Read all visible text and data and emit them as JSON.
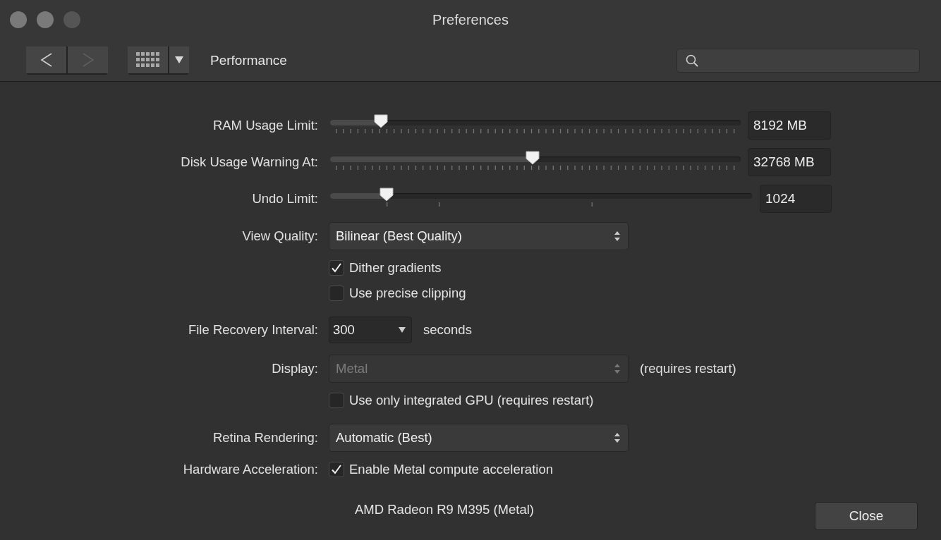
{
  "window": {
    "title": "Preferences"
  },
  "toolbar": {
    "nav_buttons": [
      {
        "kind": "back",
        "disabled": false
      },
      {
        "kind": "forward",
        "disabled": true
      }
    ],
    "section": "Performance"
  },
  "settings": [
    {
      "kind": "slider",
      "label": "RAM Usage Limit:",
      "level": 0.124,
      "value": "8192 MB"
    },
    {
      "kind": "slider",
      "label": "Disk Usage Warning At:",
      "level": 0.493,
      "value": "32768 MB"
    },
    {
      "kind": "stepslider",
      "label": "Undo Limit:",
      "level": 0.134,
      "value": "1024"
    },
    {
      "kind": "select",
      "label": "View Quality:",
      "value": "Bilinear (Best Quality)",
      "disabled": false
    },
    {
      "kind": "checkbox",
      "text": "Dither gradients",
      "checked": true
    },
    {
      "kind": "checkbox",
      "text": "Use precise clipping",
      "checked": false
    },
    {
      "kind": "combo",
      "label": "File Recovery Interval:",
      "value": "300",
      "suffix": "seconds"
    },
    {
      "kind": "select",
      "label": "Display:",
      "value": "Metal",
      "disabled": true,
      "suffix": "(requires restart)"
    },
    {
      "kind": "checkbox",
      "text": "Use only integrated GPU (requires restart)",
      "checked": false
    },
    {
      "kind": "select",
      "label": "Retina Rendering:",
      "value": "Automatic (Best)",
      "disabled": false
    },
    {
      "kind": "checkbox",
      "label": "Hardware Acceleration:",
      "text": "Enable Metal compute acceleration",
      "checked": true
    },
    {
      "kind": "note",
      "text": "AMD Radeon R9 M395 (Metal)"
    }
  ],
  "buttons": [
    {
      "label": "Close"
    }
  ]
}
